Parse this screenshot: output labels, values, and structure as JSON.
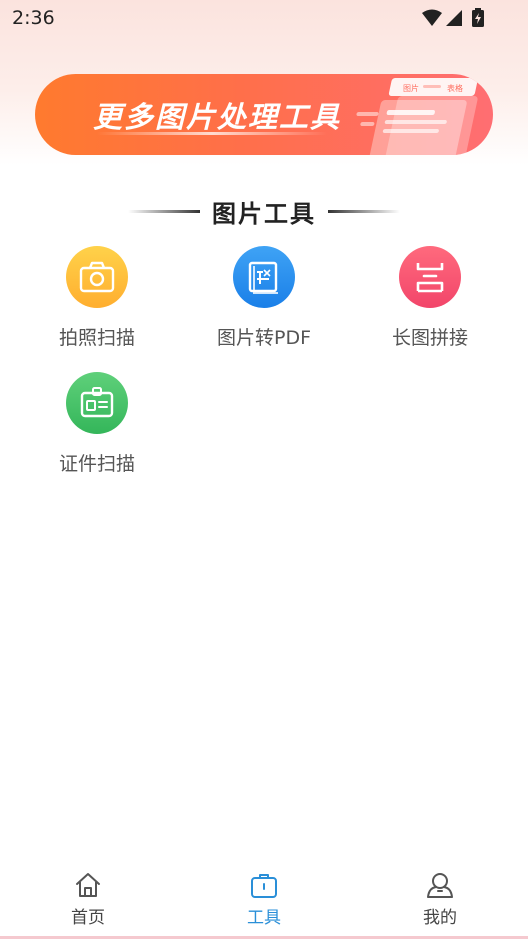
{
  "status_bar": {
    "time": "2:36"
  },
  "banner": {
    "title": "更多图片处理工具",
    "art_tab_1": "图片",
    "art_tab_2": "表格"
  },
  "section": {
    "title": "图片工具"
  },
  "tools": [
    {
      "label": "拍照扫描",
      "icon": "camera-icon",
      "color": "#ffc13e"
    },
    {
      "label": "图片转PDF",
      "icon": "pdf-document-icon",
      "color": "#2d92ef"
    },
    {
      "label": "长图拼接",
      "icon": "stitch-icon",
      "color": "#f7566f"
    },
    {
      "label": "证件扫描",
      "icon": "id-card-icon",
      "color": "#46c467"
    }
  ],
  "bottom_nav": {
    "items": [
      {
        "label": "首页",
        "icon": "home-icon",
        "active": false
      },
      {
        "label": "工具",
        "icon": "toolbox-icon",
        "active": true
      },
      {
        "label": "我的",
        "icon": "user-icon",
        "active": false
      }
    ]
  },
  "colors": {
    "accent": "#2a8fd8",
    "banner_start": "#ff7a2e",
    "banner_end": "#ff6e72"
  }
}
